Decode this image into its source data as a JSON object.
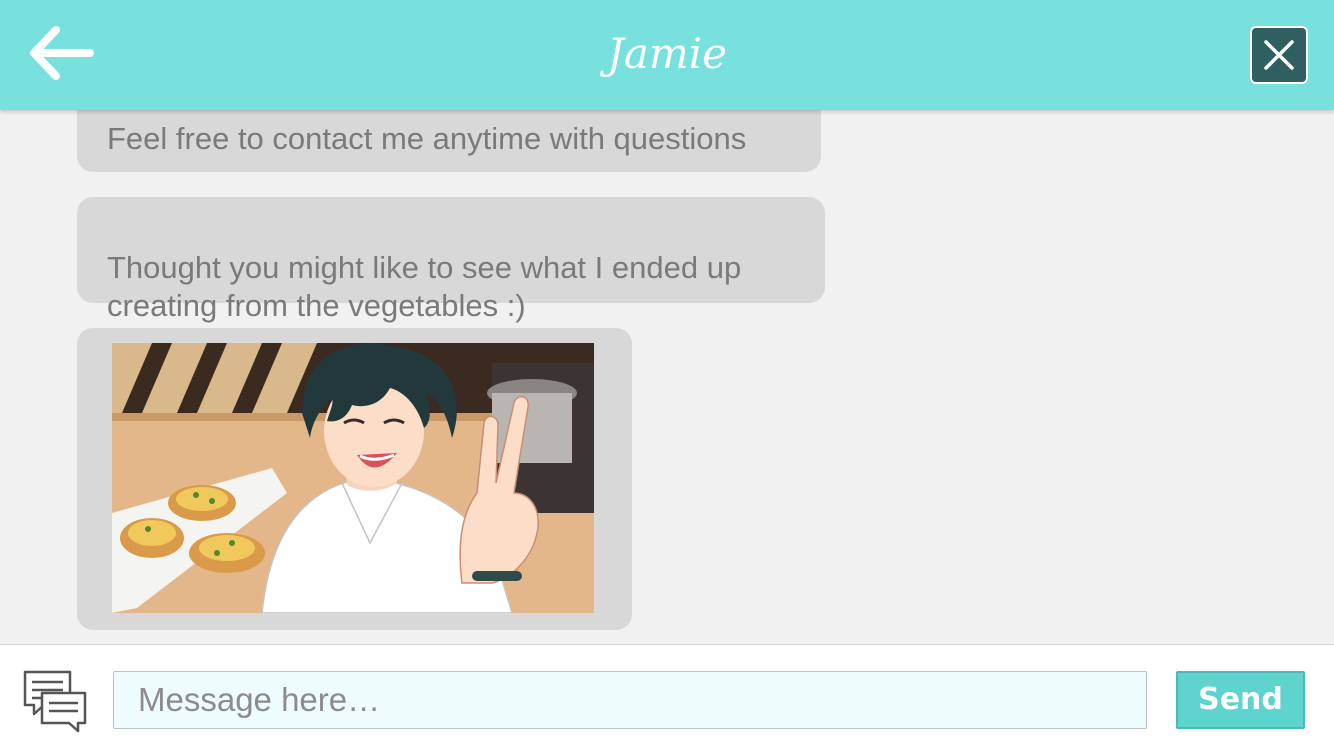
{
  "header": {
    "title": "Jamie",
    "back_icon": "arrow-left-icon",
    "close_icon": "close-icon",
    "colors": {
      "bar": "#78e1de",
      "close_bg": "#2f5f61"
    }
  },
  "messages": [
    {
      "type": "text",
      "text": "Feel free to contact me anytime with questions"
    },
    {
      "type": "text",
      "text": "Thought you might like to see what I ended up\ncreating from the vegetables :)"
    },
    {
      "type": "image",
      "icon": "photo-selfie-peace-sign"
    }
  ],
  "composer": {
    "icon": "chat-bubbles-icon",
    "placeholder": "Message here…",
    "value": "",
    "send_label": "Send",
    "colors": {
      "send_bg": "#5fd3cd",
      "input_bg": "#effcfd"
    }
  }
}
